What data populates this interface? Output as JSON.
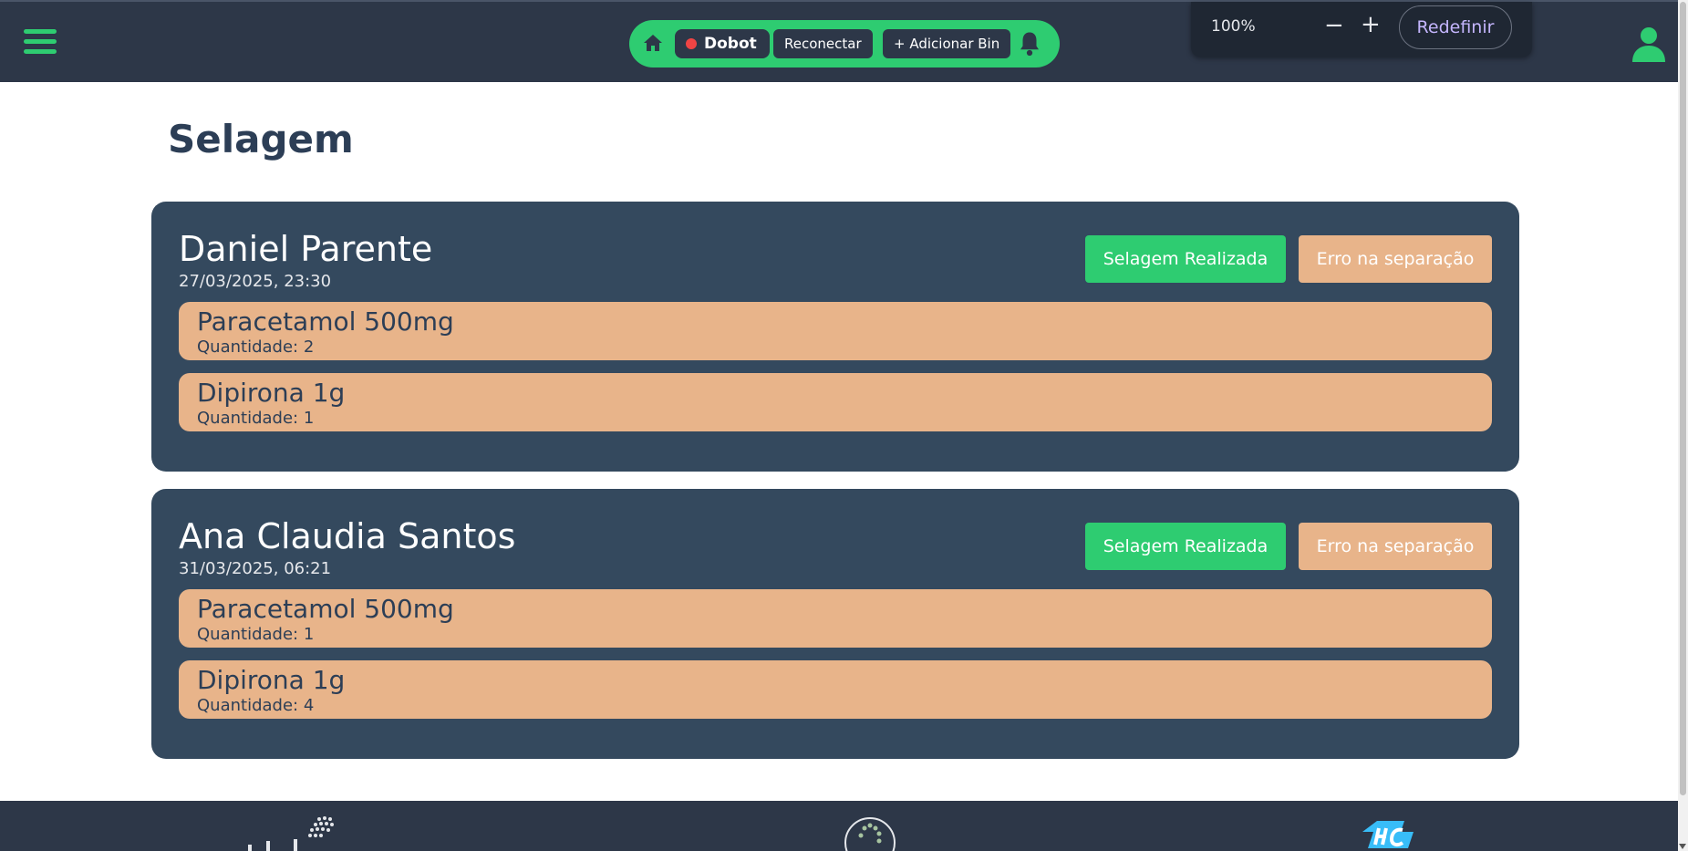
{
  "header": {
    "dobot_label": "Dobot",
    "reconnect_label": "Reconectar",
    "add_bin_label": "+ Adicionar Bin",
    "status_color": "#ef4444",
    "accent_color": "#2ecc71"
  },
  "zoom": {
    "level": "100%",
    "minus": "−",
    "plus": "+",
    "reset_label": "Redefinir"
  },
  "page": {
    "title": "Selagem"
  },
  "actions": {
    "done_label": "Selagem Realizada",
    "error_label": "Erro na separação"
  },
  "orders": [
    {
      "patient": "Daniel Parente",
      "date": "27/03/2025, 23:30",
      "items": [
        {
          "name": "Paracetamol 500mg",
          "qty": "Quantidade: 2"
        },
        {
          "name": "Dipirona 1g",
          "qty": "Quantidade: 1"
        }
      ]
    },
    {
      "patient": "Ana Claudia Santos",
      "date": "31/03/2025, 06:21",
      "items": [
        {
          "name": "Paracetamol 500mg",
          "qty": "Quantidade: 1"
        },
        {
          "name": "Dipirona 1g",
          "qty": "Quantidade: 4"
        }
      ]
    }
  ],
  "icons": [
    "menu-icon",
    "home-icon",
    "bell-icon",
    "user-icon"
  ],
  "colors": {
    "topbar": "#2d3748",
    "card": "#34495e",
    "item": "#e8b48a",
    "success": "#2ecc71"
  }
}
